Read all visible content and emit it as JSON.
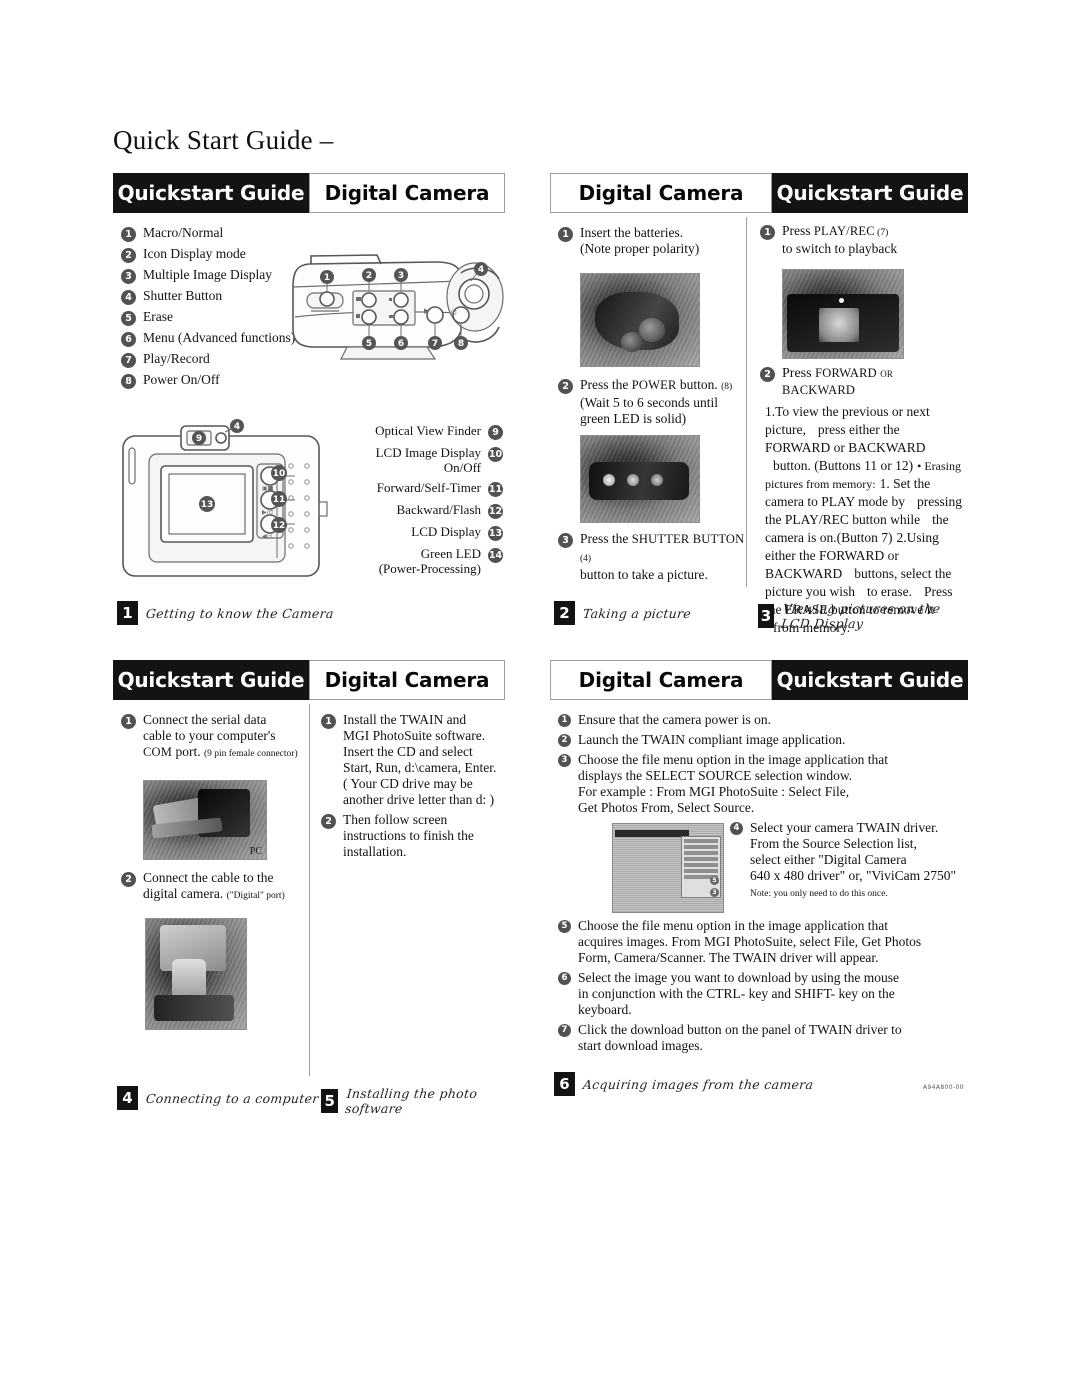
{
  "document": {
    "title": "Quick Start Guide –"
  },
  "brand": {
    "quickstart": "Quickstart Guide",
    "product": "Digital Camera"
  },
  "panel1": {
    "caption_number": "1",
    "caption_text": "Getting to know the Camera",
    "left_list": [
      {
        "n": "1",
        "label": "Macro/Normal"
      },
      {
        "n": "2",
        "label": "Icon Display mode"
      },
      {
        "n": "3",
        "label": "Multiple Image Display"
      },
      {
        "n": "4",
        "label": "Shutter Button"
      },
      {
        "n": "5",
        "label": "Erase"
      },
      {
        "n": "6",
        "label": "Menu (Advanced functions)"
      },
      {
        "n": "7",
        "label": "Play/Record"
      },
      {
        "n": "8",
        "label": "Power On/Off"
      }
    ],
    "right_list": [
      {
        "n": "9",
        "label": "Optical View Finder"
      },
      {
        "n": "10",
        "label": "LCD Image Display\nOn/Off"
      },
      {
        "n": "11",
        "label": "Forward/Self-Timer"
      },
      {
        "n": "12",
        "label": "Backward/Flash"
      },
      {
        "n": "13",
        "label": "LCD Display"
      },
      {
        "n": "14",
        "label": "Green LED\n(Power-Processing)"
      }
    ],
    "diagram_top_callouts": [
      "1",
      "2",
      "3",
      "4",
      "5",
      "6",
      "7",
      "8"
    ],
    "diagram_back_callouts": [
      "4",
      "9",
      "10",
      "11",
      "12",
      "13"
    ]
  },
  "panel2": {
    "caption_number": "2",
    "caption_text": "Taking a picture",
    "steps": [
      {
        "n": "1",
        "line1": "Insert the batteries.",
        "line2": "(Note proper polarity)",
        "has_photo": true
      },
      {
        "n": "2",
        "line1_pre": "Press the ",
        "line1_sc": "POWER",
        "line1_post": " button. ",
        "line1_ref": "(8)",
        "line2": "(Wait 5 to 6 seconds until",
        "line3": "green LED is solid)",
        "has_photo": true
      },
      {
        "n": "3",
        "line1_pre": "Press the ",
        "line1_sc": "SHUTTER BUTTON",
        "line1_ref": " (4)",
        "line2": "button to take a picture.",
        "has_photo": false
      }
    ]
  },
  "panel3": {
    "caption_number": "3",
    "caption_text": "Viewing pictures on the LCD Display",
    "step1": {
      "n": "1",
      "pre": "Press ",
      "sc": "PLAY/REC",
      "ref": " (7)",
      "line2": "to switch to playback"
    },
    "step2": {
      "n": "2",
      "head_pre": "Press ",
      "head_sc": "FORWARD or BACKWARD",
      "lines": [
        "1.To view the previous or next picture,",
        "press either the FORWARD or BACKWARD",
        "button. (Buttons 11 or 12)",
        "• Erasing pictures from memory:",
        "1. Set the camera to PLAY mode by",
        "pressing the PLAY/REC button while",
        "the camera is on.(Button 7)",
        "2.Using either the FORWARD or BACKWARD",
        "buttons, select the picture you wish",
        "to erase.",
        "Press the ERASE button to remove it",
        "from memory."
      ]
    }
  },
  "panel4": {
    "caption_number": "4",
    "caption_text": "Connecting to a computer",
    "steps": [
      {
        "n": "1",
        "line1": "Connect the serial data",
        "line2": "cable to your computer's",
        "line3_sc": "COM",
        "line3_mid": " port. ",
        "line3_note": "(9 pin female connector)",
        "photo_label": "PC"
      },
      {
        "n": "2",
        "line1": "Connect the cable to the",
        "line2": "digital camera. ",
        "line2_note": "(\"Digital\" port)"
      }
    ]
  },
  "panel5": {
    "caption_number": "5",
    "caption_text": "Installing the photo software",
    "steps": [
      {
        "n": "1",
        "lines": [
          "Install the TWAIN and",
          "MGI PhotoSuite software.",
          "Insert the CD and select",
          "Start, Run, d:\\camera, Enter.",
          "( Your CD drive may be",
          "another drive letter than d: )"
        ]
      },
      {
        "n": "2",
        "lines": [
          "Then follow screen",
          "instructions to finish the",
          "installation."
        ]
      }
    ]
  },
  "panel6": {
    "caption_number": "6",
    "caption_text": "Acquiring images from the camera",
    "fineprint": "A94A800-00",
    "steps": [
      {
        "n": "1",
        "lines": [
          "Ensure that the camera power is on."
        ]
      },
      {
        "n": "2",
        "lines": [
          "Launch the TWAIN compliant image application."
        ]
      },
      {
        "n": "3",
        "lines": [
          "Choose the file menu option in the image application that",
          "displays the SELECT SOURCE selection window.",
          "For example : From MGI  PhotoSuite : Select File,",
          "Get Photos From, Select Source."
        ]
      },
      {
        "n": "4",
        "lines": [
          "Select your camera TWAIN driver.",
          "From the Source Selection list,",
          "select either \"Digital Camera",
          "640 x 480 driver\" or, \"ViviCam 2750\"",
          "Note: you only need to do this once."
        ]
      },
      {
        "n": "5",
        "lines": [
          "Choose the file menu option in the image application that",
          "acquires images. From MGI PhotoSuite, select File, Get Photos",
          "Form, Camera/Scanner. The TWAIN driver will appear."
        ]
      },
      {
        "n": "6",
        "lines": [
          "Select the image you want to download by using the mouse",
          "in conjunction with the CTRL- key and SHIFT- key on the",
          "keyboard."
        ]
      },
      {
        "n": "7",
        "lines": [
          "Click the download button on the panel of TWAIN driver to",
          "start download images."
        ]
      }
    ],
    "thumb_badges": [
      "5",
      "3"
    ]
  }
}
